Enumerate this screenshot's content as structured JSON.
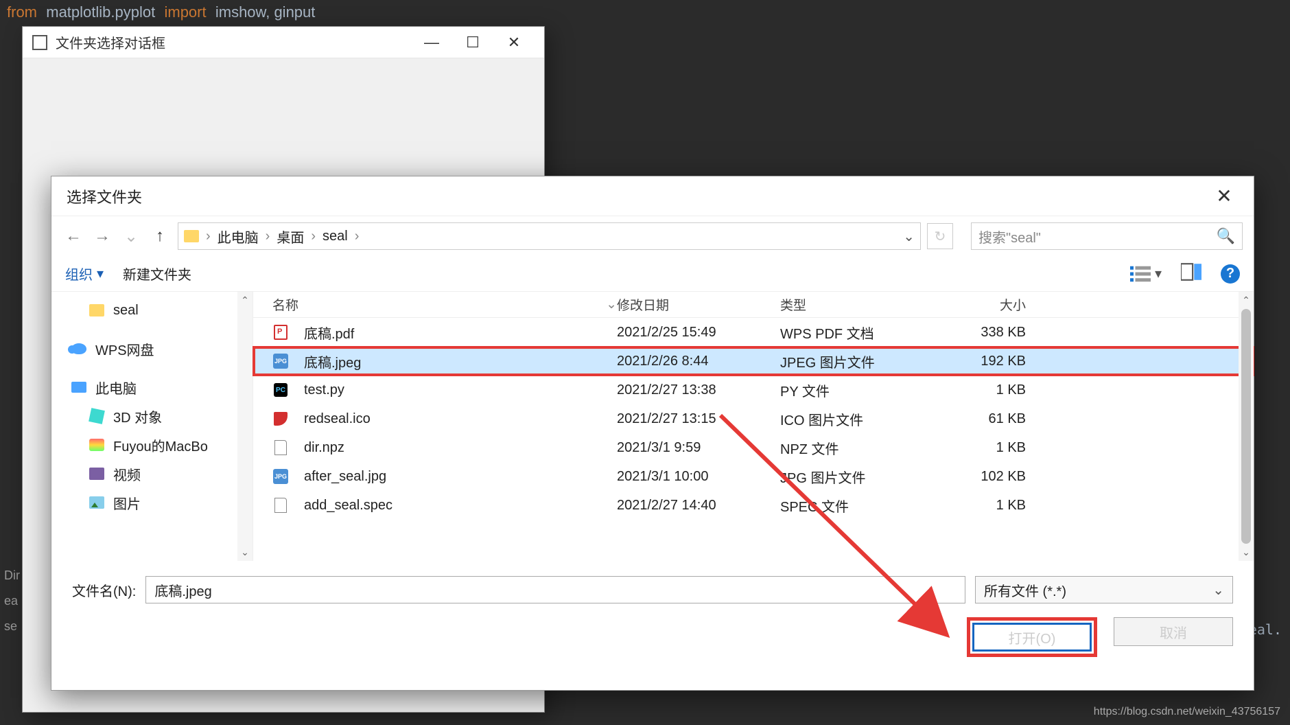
{
  "background": {
    "code_line": "from matplotlib.pyplot import imshow, ginput",
    "left_tags": [
      "Dir",
      "ea",
      "se"
    ],
    "right_snippet": "seal."
  },
  "parent_window": {
    "title": "文件夹选择对话框"
  },
  "file_dialog": {
    "title": "选择文件夹",
    "nav": {
      "path_root": "此电脑",
      "path_mid": "桌面",
      "path_leaf": "seal",
      "search_placeholder": "搜索\"seal\""
    },
    "toolbar": {
      "organize": "组织",
      "new_folder": "新建文件夹"
    },
    "tree": {
      "items": [
        {
          "label": "seal",
          "indent": true,
          "icon": "folder"
        },
        {
          "label": "WPS网盘",
          "indent": false,
          "icon": "wps"
        },
        {
          "label": "此电脑",
          "indent": false,
          "icon": "pc"
        },
        {
          "label": "3D 对象",
          "indent": true,
          "icon": "3d"
        },
        {
          "label": "Fuyou的MacBo",
          "indent": true,
          "icon": "mac"
        },
        {
          "label": "视频",
          "indent": true,
          "icon": "video"
        },
        {
          "label": "图片",
          "indent": true,
          "icon": "pic"
        }
      ]
    },
    "columns": {
      "name": "名称",
      "date": "修改日期",
      "type": "类型",
      "size": "大小"
    },
    "files": [
      {
        "name": "底稿.pdf",
        "date": "2021/2/25 15:49",
        "type": "WPS PDF 文档",
        "size": "338 KB",
        "icon": "pdf",
        "selected": false
      },
      {
        "name": "底稿.jpeg",
        "date": "2021/2/26 8:44",
        "type": "JPEG 图片文件",
        "size": "192 KB",
        "icon": "jpg",
        "selected": true
      },
      {
        "name": "test.py",
        "date": "2021/2/27 13:38",
        "type": "PY 文件",
        "size": "1 KB",
        "icon": "py",
        "selected": false
      },
      {
        "name": "redseal.ico",
        "date": "2021/2/27 13:15",
        "type": "ICO 图片文件",
        "size": "61 KB",
        "icon": "ico",
        "selected": false
      },
      {
        "name": "dir.npz",
        "date": "2021/3/1 9:59",
        "type": "NPZ 文件",
        "size": "1 KB",
        "icon": "file",
        "selected": false
      },
      {
        "name": "after_seal.jpg",
        "date": "2021/3/1 10:00",
        "type": "JPG 图片文件",
        "size": "102 KB",
        "icon": "jpg",
        "selected": false
      },
      {
        "name": "add_seal.spec",
        "date": "2021/2/27 14:40",
        "type": "SPEC 文件",
        "size": "1 KB",
        "icon": "file",
        "selected": false
      }
    ],
    "bottom": {
      "filename_label": "文件名(N):",
      "filename_value": "底稿.jpeg",
      "filter": "所有文件 (*.*)",
      "open": "打开(O)",
      "cancel": "取消"
    }
  },
  "watermark": "https://blog.csdn.net/weixin_43756157"
}
